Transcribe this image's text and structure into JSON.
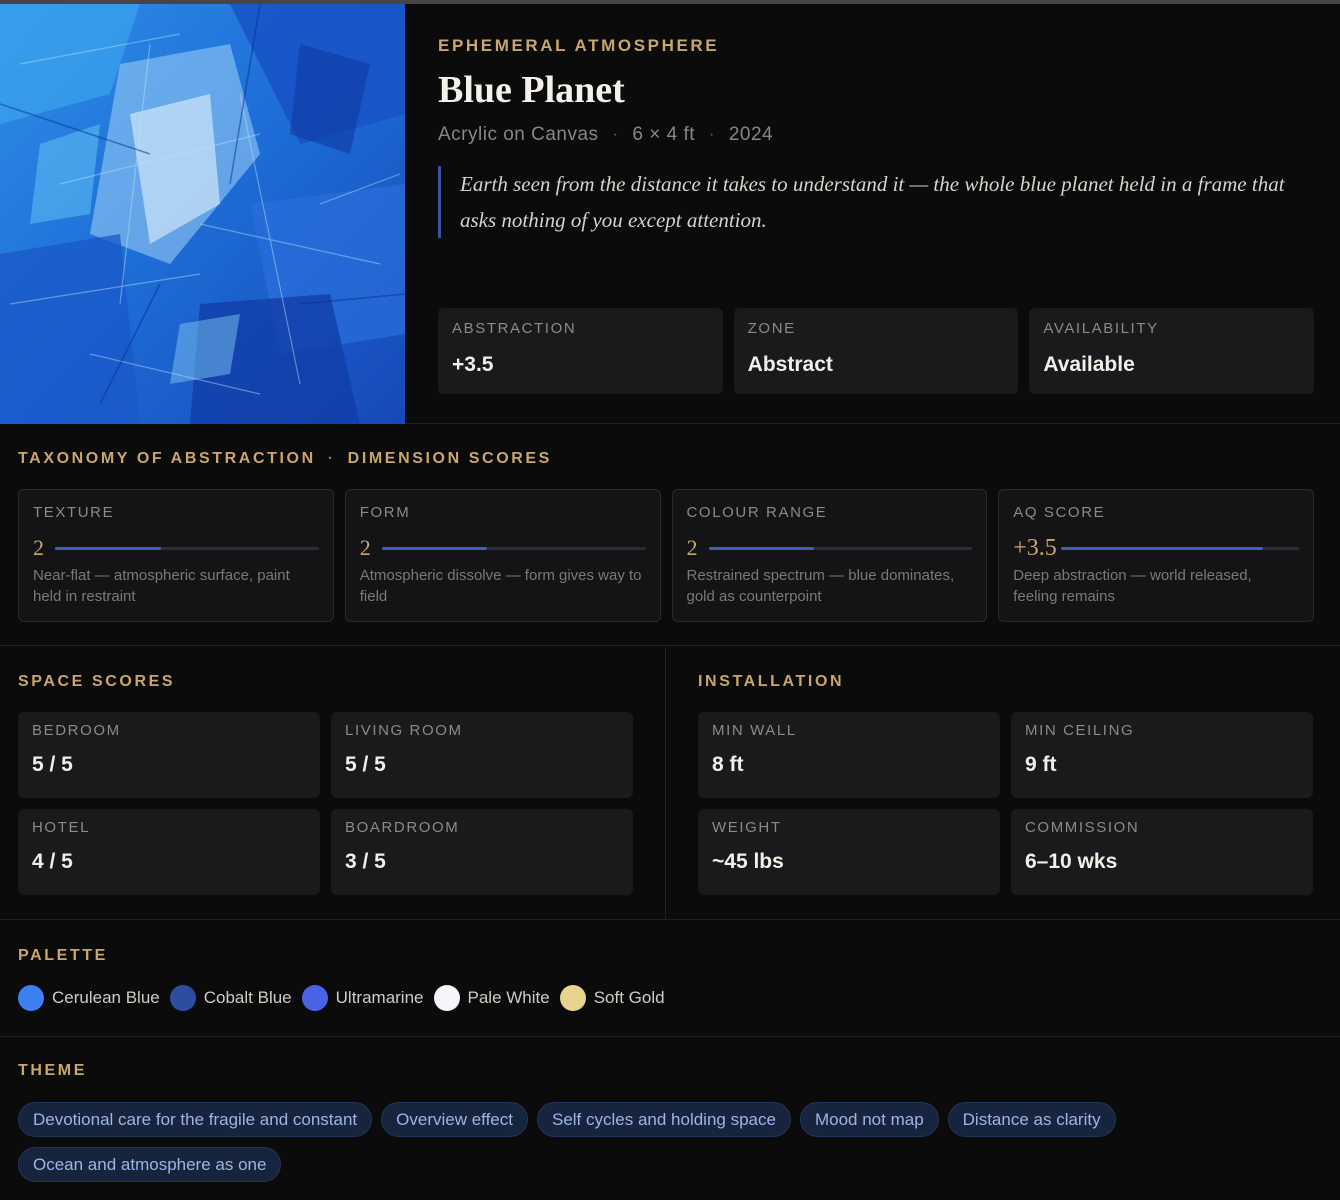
{
  "artwork": {
    "collection": "EPHEMERAL ATMOSPHERE",
    "title": "Blue Planet",
    "medium": "Acrylic on Canvas",
    "size": "6 × 4 ft",
    "year": "2024",
    "separator": "·",
    "statement": "Earth seen from the distance it takes to understand it — the whole blue planet held in a frame that asks nothing of you except attention."
  },
  "hero_cards": [
    {
      "label": "ABSTRACTION",
      "value": "+3.5"
    },
    {
      "label": "ZONE",
      "value": "Abstract"
    },
    {
      "label": "AVAILABILITY",
      "value": "Available"
    }
  ],
  "taxonomy": {
    "heading": "TAXONOMY OF ABSTRACTION",
    "separator": "·",
    "subheading": "DIMENSION SCORES",
    "dimensions": [
      {
        "label": "TEXTURE",
        "score": "2",
        "fill": 0.4,
        "desc": "Near-flat — atmospheric surface, paint held in restraint"
      },
      {
        "label": "FORM",
        "score": "2",
        "fill": 0.4,
        "desc": "Atmospheric dissolve — form gives way to field"
      },
      {
        "label": "COLOUR RANGE",
        "score": "2",
        "fill": 0.4,
        "desc": "Restrained spectrum — blue dominates, gold as counterpoint"
      },
      {
        "label": "AQ SCORE",
        "score": "+3.5",
        "fill": 0.85,
        "desc": "Deep abstraction — world released, feeling remains"
      }
    ]
  },
  "space_scores": {
    "heading": "SPACE SCORES",
    "items": [
      {
        "label": "BEDROOM",
        "value": "5 / 5"
      },
      {
        "label": "LIVING ROOM",
        "value": "5 / 5"
      },
      {
        "label": "HOTEL",
        "value": "4 / 5"
      },
      {
        "label": "BOARDROOM",
        "value": "3 / 5"
      }
    ]
  },
  "installation": {
    "heading": "INSTALLATION",
    "items": [
      {
        "label": "MIN WALL",
        "value": "8 ft"
      },
      {
        "label": "MIN CEILING",
        "value": "9 ft"
      },
      {
        "label": "WEIGHT",
        "value": "~45 lbs"
      },
      {
        "label": "COMMISSION",
        "value": "6–10 wks"
      }
    ]
  },
  "palette": {
    "heading": "PALETTE",
    "colors": [
      {
        "name": "Cerulean Blue",
        "hex": "#3b7ff0"
      },
      {
        "name": "Cobalt Blue",
        "hex": "#2d4ea0"
      },
      {
        "name": "Ultramarine",
        "hex": "#4a63e6"
      },
      {
        "name": "Pale White",
        "hex": "#f4f6fb"
      },
      {
        "name": "Soft Gold",
        "hex": "#e9d48f"
      }
    ]
  },
  "theme": {
    "heading": "THEME",
    "tags": [
      "Devotional care for the fragile and constant",
      "Overview effect",
      "Self cycles and holding space",
      "Mood not map",
      "Distance as clarity",
      "Ocean and atmosphere as one"
    ]
  }
}
